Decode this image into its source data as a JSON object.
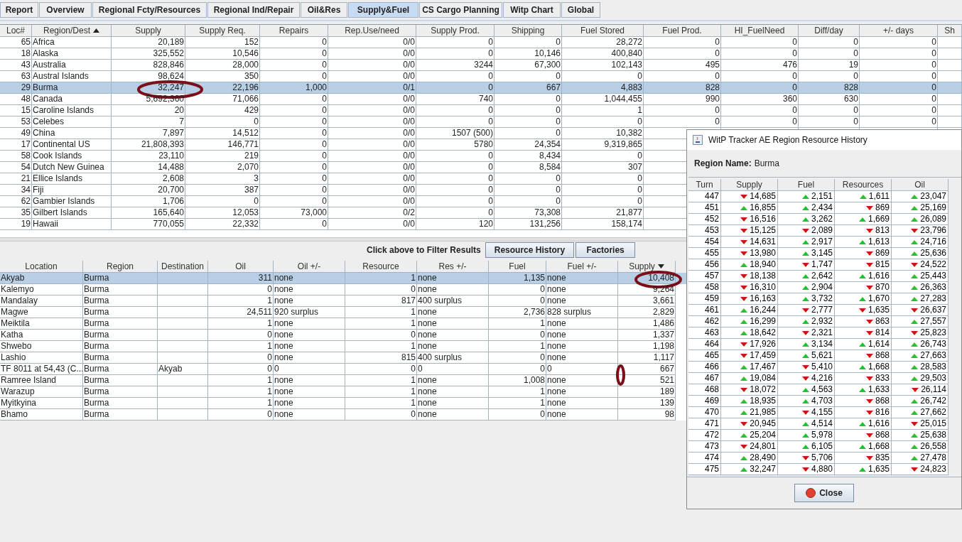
{
  "tabs": [
    {
      "label": "Report",
      "selected": false
    },
    {
      "label": "Overview",
      "selected": false
    },
    {
      "label": "Regional Fcty/Resources",
      "selected": false
    },
    {
      "label": "Regional Ind/Repair",
      "selected": false
    },
    {
      "label": "Oil&Res",
      "selected": false
    },
    {
      "label": "Supply&Fuel",
      "selected": true
    },
    {
      "label": "CS Cargo Planning",
      "selected": false
    },
    {
      "label": "Witp Chart",
      "selected": false
    },
    {
      "label": "Global",
      "selected": false
    }
  ],
  "region_table": {
    "columns": [
      {
        "label": "Loc#",
        "kind": "number",
        "sorted": false
      },
      {
        "label": "Region/Dest",
        "kind": "text",
        "sorted": true,
        "descending": false
      },
      {
        "label": "Supply",
        "kind": "number",
        "sorted": false
      },
      {
        "label": "Supply Req.",
        "kind": "number",
        "sorted": false
      },
      {
        "label": "Repairs",
        "kind": "number",
        "sorted": false
      },
      {
        "label": "Rep.Use/need",
        "kind": "number",
        "sorted": false
      },
      {
        "label": "Supply Prod.",
        "kind": "number",
        "sorted": false
      },
      {
        "label": "Shipping",
        "kind": "number",
        "sorted": false
      },
      {
        "label": "Fuel Stored",
        "kind": "number",
        "sorted": false
      },
      {
        "label": "Fuel Prod.",
        "kind": "number",
        "sorted": false
      },
      {
        "label": "HI_FuelNeed",
        "kind": "number",
        "sorted": false
      },
      {
        "label": "Diff/day",
        "kind": "number",
        "sorted": false
      },
      {
        "label": "+/- days",
        "kind": "number",
        "sorted": false
      },
      {
        "label": "Sh",
        "kind": "text",
        "sorted": false
      }
    ],
    "rows": [
      {
        "selected": false,
        "cells": [
          "65",
          "Africa",
          "20,189",
          "152",
          "0",
          "0/0",
          "0",
          "0",
          "28,272",
          "0",
          "0",
          "0",
          "0"
        ]
      },
      {
        "selected": false,
        "cells": [
          "18",
          "Alaska",
          "325,552",
          "10,546",
          "0",
          "0/0",
          "0",
          "10,146",
          "400,840",
          "0",
          "0",
          "0",
          "0"
        ]
      },
      {
        "selected": false,
        "cells": [
          "43",
          "Australia",
          "828,846",
          "28,000",
          "0",
          "0/0",
          "3244",
          "67,300",
          "102,143",
          "495",
          "476",
          "19",
          "0"
        ]
      },
      {
        "selected": false,
        "cells": [
          "63",
          "Austral Islands",
          "98,624",
          "350",
          "0",
          "0/0",
          "0",
          "0",
          "0",
          "0",
          "0",
          "0",
          "0"
        ]
      },
      {
        "selected": true,
        "cells": [
          "29",
          "Burma",
          "32,247",
          "22,196",
          "1,000",
          "0/1",
          "0",
          "667",
          "4,883",
          "828",
          "0",
          "828",
          "0"
        ]
      },
      {
        "selected": false,
        "cells": [
          "48",
          "Canada",
          "5,692,360",
          "71,066",
          "0",
          "0/0",
          "740",
          "0",
          "1,044,455",
          "990",
          "360",
          "630",
          "0"
        ]
      },
      {
        "selected": false,
        "cells": [
          "15",
          "Caroline Islands",
          "20",
          "429",
          "0",
          "0/0",
          "0",
          "0",
          "1",
          "0",
          "0",
          "0",
          "0"
        ]
      },
      {
        "selected": false,
        "cells": [
          "53",
          "Celebes",
          "7",
          "0",
          "0",
          "0/0",
          "0",
          "0",
          "0",
          "0",
          "0",
          "0",
          "0"
        ]
      },
      {
        "selected": false,
        "cells": [
          "49",
          "China",
          "7,897",
          "14,512",
          "0",
          "0/0",
          "1507 (500)",
          "0",
          "10,382"
        ]
      },
      {
        "selected": false,
        "cells": [
          "17",
          "Continental US",
          "21,808,393",
          "146,771",
          "0",
          "0/0",
          "5780",
          "24,354",
          "9,319,865"
        ]
      },
      {
        "selected": false,
        "cells": [
          "58",
          "Cook Islands",
          "23,110",
          "219",
          "0",
          "0/0",
          "0",
          "8,434",
          "0"
        ]
      },
      {
        "selected": false,
        "cells": [
          "54",
          "Dutch New Guinea",
          "14,488",
          "2,070",
          "0",
          "0/0",
          "0",
          "8,584",
          "307"
        ]
      },
      {
        "selected": false,
        "cells": [
          "21",
          "Ellice Islands",
          "2,608",
          "3",
          "0",
          "0/0",
          "0",
          "0",
          "0"
        ]
      },
      {
        "selected": false,
        "cells": [
          "34",
          "Fiji",
          "20,700",
          "387",
          "0",
          "0/0",
          "0",
          "0",
          "0"
        ]
      },
      {
        "selected": false,
        "cells": [
          "62",
          "Gambier Islands",
          "1,706",
          "0",
          "0",
          "0/0",
          "0",
          "0",
          "0"
        ]
      },
      {
        "selected": false,
        "cells": [
          "35",
          "Gilbert Islands",
          "165,640",
          "12,053",
          "73,000",
          "0/2",
          "0",
          "73,308",
          "21,877"
        ]
      },
      {
        "selected": false,
        "cells": [
          "19",
          "Hawaii",
          "770,055",
          "22,332",
          "0",
          "0/0",
          "120",
          "131,256",
          "158,174"
        ]
      }
    ]
  },
  "filter_bar": {
    "hint": "Click above to Filter Results",
    "buttons": [
      "Resource History",
      "Factories"
    ]
  },
  "location_table": {
    "columns": [
      {
        "label": "Location",
        "kind": "text",
        "sorted": false
      },
      {
        "label": "Region",
        "kind": "text",
        "sorted": false
      },
      {
        "label": "Destination",
        "kind": "text",
        "sorted": false
      },
      {
        "label": "Oil",
        "kind": "number",
        "sorted": false
      },
      {
        "label": "Oil +/-",
        "kind": "text",
        "sorted": false
      },
      {
        "label": "Resource",
        "kind": "number",
        "sorted": false
      },
      {
        "label": "Res +/-",
        "kind": "text",
        "sorted": false
      },
      {
        "label": "Fuel",
        "kind": "number",
        "sorted": false
      },
      {
        "label": "Fuel +/-",
        "kind": "text",
        "sorted": false
      },
      {
        "label": "Supply",
        "kind": "number",
        "sorted": true,
        "descending": true
      }
    ],
    "rows": [
      {
        "selected": true,
        "cells": [
          "Akyab",
          "Burma",
          "",
          "311",
          "none",
          "1",
          "none",
          "1,135",
          "none",
          "10,408"
        ]
      },
      {
        "selected": false,
        "cells": [
          "Kalemyo",
          "Burma",
          "",
          "0",
          "none",
          "0",
          "none",
          "0",
          "none",
          "9,264"
        ]
      },
      {
        "selected": false,
        "cells": [
          "Mandalay",
          "Burma",
          "",
          "1",
          "none",
          "817",
          "400 surplus",
          "0",
          "none",
          "3,661"
        ]
      },
      {
        "selected": false,
        "cells": [
          "Magwe",
          "Burma",
          "",
          "24,511",
          "920 surplus",
          "1",
          "none",
          "2,736",
          "828 surplus",
          "2,829"
        ]
      },
      {
        "selected": false,
        "cells": [
          "Meiktila",
          "Burma",
          "",
          "1",
          "none",
          "1",
          "none",
          "1",
          "none",
          "1,486"
        ]
      },
      {
        "selected": false,
        "cells": [
          "Katha",
          "Burma",
          "",
          "0",
          "none",
          "0",
          "none",
          "0",
          "none",
          "1,337"
        ]
      },
      {
        "selected": false,
        "cells": [
          "Shwebo",
          "Burma",
          "",
          "1",
          "none",
          "1",
          "none",
          "1",
          "none",
          "1,198"
        ]
      },
      {
        "selected": false,
        "cells": [
          "Lashio",
          "Burma",
          "",
          "0",
          "none",
          "815",
          "400 surplus",
          "0",
          "none",
          "1,117"
        ]
      },
      {
        "selected": false,
        "cells": [
          "TF 8011 at 54,43 (C...",
          "Burma",
          "Akyab",
          "0",
          "0",
          "0",
          "0",
          "0",
          "0",
          "667"
        ]
      },
      {
        "selected": false,
        "cells": [
          "Ramree Island",
          "Burma",
          "",
          "1",
          "none",
          "1",
          "none",
          "1,008",
          "none",
          "521"
        ]
      },
      {
        "selected": false,
        "cells": [
          "Warazup",
          "Burma",
          "",
          "1",
          "none",
          "1",
          "none",
          "1",
          "none",
          "189"
        ]
      },
      {
        "selected": false,
        "cells": [
          "Myitkyina",
          "Burma",
          "",
          "1",
          "none",
          "1",
          "none",
          "1",
          "none",
          "139"
        ]
      },
      {
        "selected": false,
        "cells": [
          "Bhamo",
          "Burma",
          "",
          "0",
          "none",
          "0",
          "none",
          "0",
          "none",
          "98"
        ]
      }
    ]
  },
  "dialog": {
    "title": "WitP Tracker AE Region Resource History",
    "region_label": "Region Name:",
    "region_value": "Burma",
    "columns": [
      "Turn",
      "Supply",
      "Fuel",
      "Resources",
      "Oil"
    ],
    "rows": [
      {
        "turn": "447",
        "cells": [
          {
            "value": "14,685",
            "rising": false
          },
          {
            "value": "2,151",
            "rising": true
          },
          {
            "value": "1,611",
            "rising": true
          },
          {
            "value": "23,047",
            "rising": true
          }
        ]
      },
      {
        "turn": "451",
        "cells": [
          {
            "value": "16,855",
            "rising": true
          },
          {
            "value": "2,434",
            "rising": true
          },
          {
            "value": "869",
            "rising": false
          },
          {
            "value": "25,169",
            "rising": true
          }
        ]
      },
      {
        "turn": "452",
        "cells": [
          {
            "value": "16,516",
            "rising": false
          },
          {
            "value": "3,262",
            "rising": true
          },
          {
            "value": "1,669",
            "rising": true
          },
          {
            "value": "26,089",
            "rising": true
          }
        ]
      },
      {
        "turn": "453",
        "cells": [
          {
            "value": "15,125",
            "rising": false
          },
          {
            "value": "2,089",
            "rising": false
          },
          {
            "value": "813",
            "rising": false
          },
          {
            "value": "23,796",
            "rising": false
          }
        ]
      },
      {
        "turn": "454",
        "cells": [
          {
            "value": "14,631",
            "rising": false
          },
          {
            "value": "2,917",
            "rising": true
          },
          {
            "value": "1,613",
            "rising": true
          },
          {
            "value": "24,716",
            "rising": true
          }
        ]
      },
      {
        "turn": "455",
        "cells": [
          {
            "value": "13,980",
            "rising": false
          },
          {
            "value": "3,145",
            "rising": true
          },
          {
            "value": "869",
            "rising": false
          },
          {
            "value": "25,636",
            "rising": true
          }
        ]
      },
      {
        "turn": "456",
        "cells": [
          {
            "value": "18,940",
            "rising": true
          },
          {
            "value": "1,747",
            "rising": false
          },
          {
            "value": "815",
            "rising": false
          },
          {
            "value": "24,522",
            "rising": false
          }
        ]
      },
      {
        "turn": "457",
        "cells": [
          {
            "value": "18,138",
            "rising": false
          },
          {
            "value": "2,642",
            "rising": true
          },
          {
            "value": "1,616",
            "rising": true
          },
          {
            "value": "25,443",
            "rising": true
          }
        ]
      },
      {
        "turn": "458",
        "cells": [
          {
            "value": "16,310",
            "rising": false
          },
          {
            "value": "2,904",
            "rising": true
          },
          {
            "value": "870",
            "rising": false
          },
          {
            "value": "26,363",
            "rising": true
          }
        ]
      },
      {
        "turn": "459",
        "cells": [
          {
            "value": "16,163",
            "rising": false
          },
          {
            "value": "3,732",
            "rising": true
          },
          {
            "value": "1,670",
            "rising": true
          },
          {
            "value": "27,283",
            "rising": true
          }
        ]
      },
      {
        "turn": "461",
        "cells": [
          {
            "value": "16,244",
            "rising": true
          },
          {
            "value": "2,777",
            "rising": false
          },
          {
            "value": "1,635",
            "rising": false
          },
          {
            "value": "26,637",
            "rising": false
          }
        ]
      },
      {
        "turn": "462",
        "cells": [
          {
            "value": "16,299",
            "rising": true
          },
          {
            "value": "2,932",
            "rising": true
          },
          {
            "value": "863",
            "rising": false
          },
          {
            "value": "27,557",
            "rising": true
          }
        ]
      },
      {
        "turn": "463",
        "cells": [
          {
            "value": "18,642",
            "rising": true
          },
          {
            "value": "2,321",
            "rising": false
          },
          {
            "value": "814",
            "rising": false
          },
          {
            "value": "25,823",
            "rising": false
          }
        ]
      },
      {
        "turn": "464",
        "cells": [
          {
            "value": "17,926",
            "rising": false
          },
          {
            "value": "3,134",
            "rising": true
          },
          {
            "value": "1,614",
            "rising": true
          },
          {
            "value": "26,743",
            "rising": true
          }
        ]
      },
      {
        "turn": "465",
        "cells": [
          {
            "value": "17,459",
            "rising": false
          },
          {
            "value": "5,621",
            "rising": true
          },
          {
            "value": "868",
            "rising": false
          },
          {
            "value": "27,663",
            "rising": true
          }
        ]
      },
      {
        "turn": "466",
        "cells": [
          {
            "value": "17,467",
            "rising": true
          },
          {
            "value": "5,410",
            "rising": false
          },
          {
            "value": "1,668",
            "rising": true
          },
          {
            "value": "28,583",
            "rising": true
          }
        ]
      },
      {
        "turn": "467",
        "cells": [
          {
            "value": "19,084",
            "rising": true
          },
          {
            "value": "4,216",
            "rising": false
          },
          {
            "value": "833",
            "rising": false
          },
          {
            "value": "29,503",
            "rising": true
          }
        ]
      },
      {
        "turn": "468",
        "cells": [
          {
            "value": "18,072",
            "rising": false
          },
          {
            "value": "4,563",
            "rising": true
          },
          {
            "value": "1,633",
            "rising": true
          },
          {
            "value": "26,114",
            "rising": false
          }
        ]
      },
      {
        "turn": "469",
        "cells": [
          {
            "value": "18,935",
            "rising": true
          },
          {
            "value": "4,703",
            "rising": true
          },
          {
            "value": "868",
            "rising": false
          },
          {
            "value": "26,742",
            "rising": true
          }
        ]
      },
      {
        "turn": "470",
        "cells": [
          {
            "value": "21,985",
            "rising": true
          },
          {
            "value": "4,155",
            "rising": false
          },
          {
            "value": "816",
            "rising": false
          },
          {
            "value": "27,662",
            "rising": true
          }
        ]
      },
      {
        "turn": "471",
        "cells": [
          {
            "value": "20,945",
            "rising": false
          },
          {
            "value": "4,514",
            "rising": true
          },
          {
            "value": "1,616",
            "rising": true
          },
          {
            "value": "25,015",
            "rising": false
          }
        ]
      },
      {
        "turn": "472",
        "cells": [
          {
            "value": "25,204",
            "rising": true
          },
          {
            "value": "5,978",
            "rising": true
          },
          {
            "value": "868",
            "rising": false
          },
          {
            "value": "25,638",
            "rising": true
          }
        ]
      },
      {
        "turn": "473",
        "cells": [
          {
            "value": "24,801",
            "rising": false
          },
          {
            "value": "6,105",
            "rising": true
          },
          {
            "value": "1,668",
            "rising": true
          },
          {
            "value": "26,558",
            "rising": true
          }
        ]
      },
      {
        "turn": "474",
        "cells": [
          {
            "value": "28,490",
            "rising": true
          },
          {
            "value": "5,706",
            "rising": false
          },
          {
            "value": "835",
            "rising": false
          },
          {
            "value": "27,478",
            "rising": true
          }
        ]
      },
      {
        "turn": "475",
        "cells": [
          {
            "value": "32,247",
            "rising": true
          },
          {
            "value": "4,880",
            "rising": false
          },
          {
            "value": "1,635",
            "rising": true
          },
          {
            "value": "24,823",
            "rising": false
          }
        ]
      }
    ],
    "close_button": "Close"
  }
}
